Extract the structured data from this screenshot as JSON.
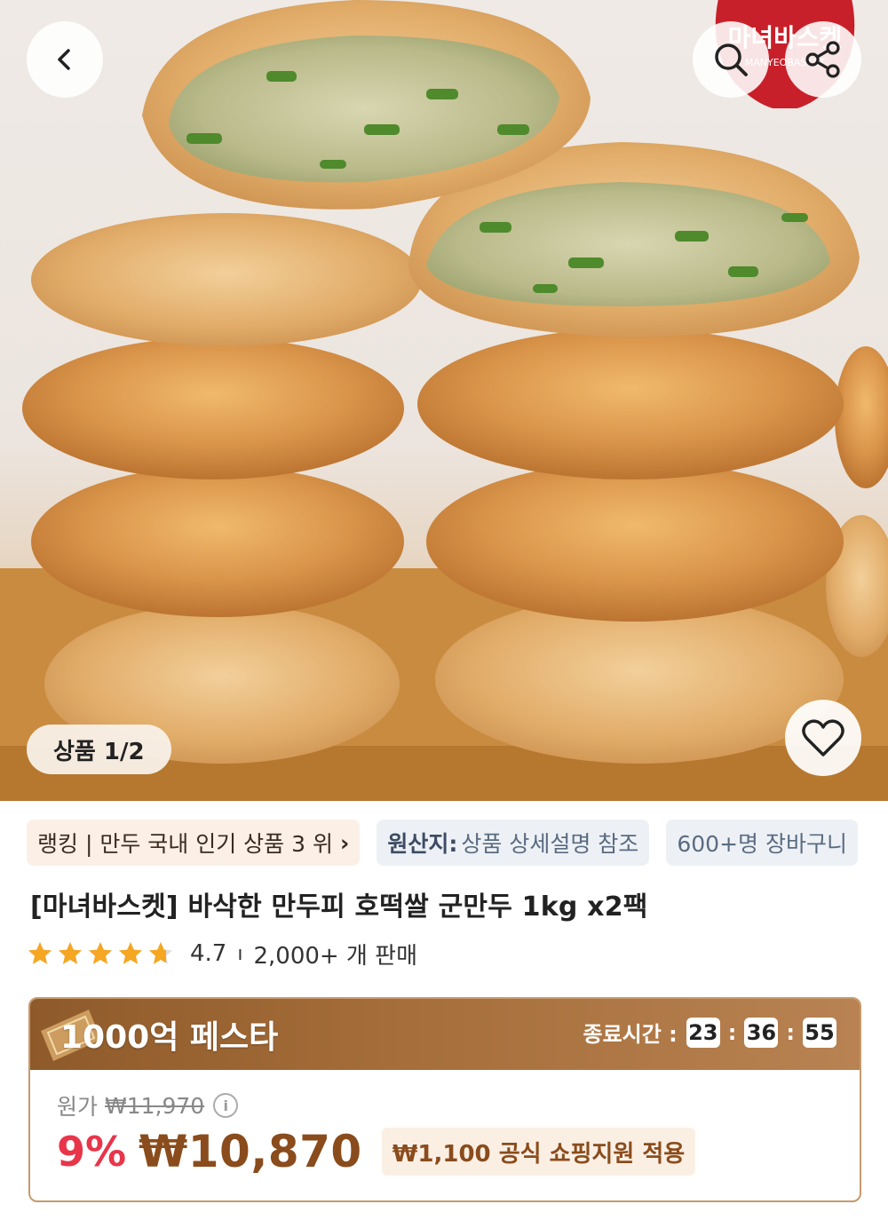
{
  "hero": {
    "image_counter": "상품 1/2",
    "brand_logo_text": "마녀바스켓",
    "brand_logo_subtext": "MANYEOBASKET",
    "icons": [
      "back-icon",
      "search-icon",
      "share-icon",
      "heart-icon"
    ]
  },
  "chips": {
    "ranking": "랭킹 | 만두 국내 인기 상품 3 위",
    "origin_label": "원산지:",
    "origin_value": "상품 상세설명 참조",
    "cart": "600+명 장바구니"
  },
  "product": {
    "title": "[마녀바스켓] 바삭한 만두피 호떡쌀 군만두 1kg x2팩",
    "rating": 4.7,
    "rating_text": "4.7",
    "rating_separator": "ı",
    "sold": "2,000+ 개 판매"
  },
  "promo": {
    "title": "1000억 페스타",
    "timer_label": "종료시간 :",
    "hours": "23",
    "minutes": "36",
    "seconds": "55",
    "original_label": "원가",
    "original_price": "₩11,970",
    "discount": "9%",
    "price": "₩10,870",
    "support": "₩1,100 공식 쇼핑지원 적용"
  },
  "colors": {
    "discount": "#e8354a",
    "price": "#8a4c1c",
    "promo_header": "#a56e3a",
    "star": "#f5a623"
  }
}
